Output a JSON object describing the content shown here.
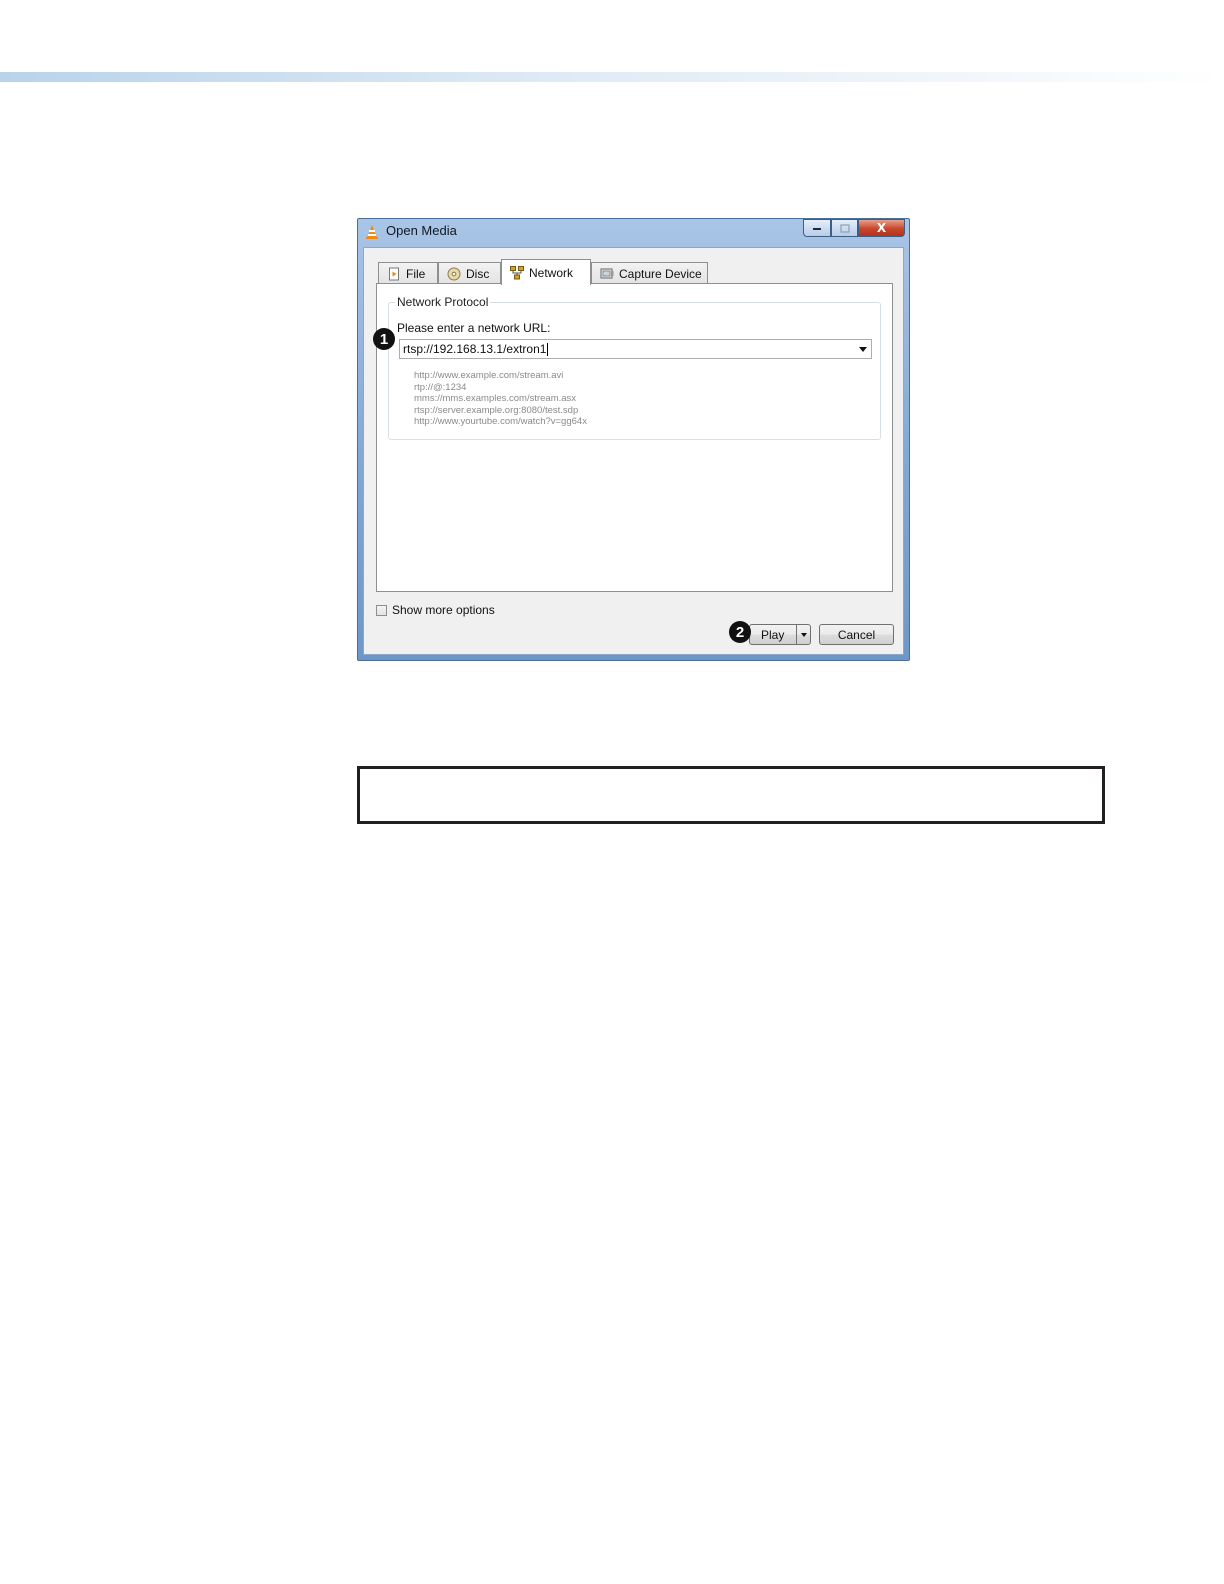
{
  "window": {
    "title": "Open Media",
    "minimize_icon": "minimize-icon",
    "maximize_icon": "maximize-icon",
    "close_label": "X"
  },
  "tabs": [
    {
      "label": "File",
      "icon": "file-icon"
    },
    {
      "label": "Disc",
      "icon": "disc-icon"
    },
    {
      "label": "Network",
      "icon": "network-icon",
      "selected": true
    },
    {
      "label": "Capture Device",
      "icon": "capture-device-icon"
    }
  ],
  "network": {
    "group_label": "Network Protocol",
    "url_label": "Please enter a network URL:",
    "url_value": "rtsp://192.168.13.1/extron1",
    "examples": [
      "http://www.example.com/stream.avi",
      "rtp://@:1234",
      "mms://mms.examples.com/stream.asx",
      "rtsp://server.example.org:8080/test.sdp",
      "http://www.yourtube.com/watch?v=gg64x"
    ]
  },
  "callouts": {
    "one": "1",
    "two": "2"
  },
  "footer": {
    "show_more_options_label": "Show more options",
    "play_label": "Play",
    "cancel_label": "Cancel"
  },
  "colors": {
    "accent": "#6e97c9",
    "close": "#c7462c"
  }
}
